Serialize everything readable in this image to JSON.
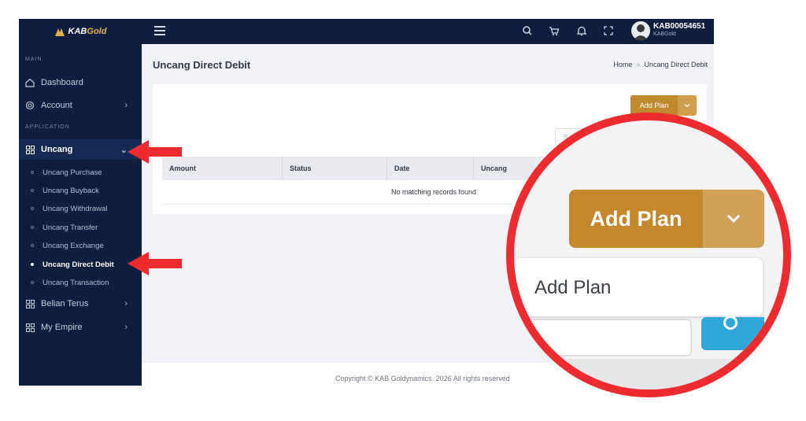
{
  "brand": {
    "logo_text": "KABGold",
    "logo_text_prefix": "KAB",
    "logo_text_suffix": "Gold"
  },
  "sidebar": {
    "section_main": "MAIN",
    "section_application": "APPLICATION",
    "items": [
      {
        "label": "Dashboard",
        "icon": "home-icon"
      },
      {
        "label": "Account",
        "icon": "fingerprint-icon",
        "has_chevron": true
      },
      {
        "label": "Uncang",
        "icon": "grid-icon",
        "active": true,
        "chevron": "⌄"
      },
      {
        "label": "Belian Terus",
        "icon": "grid-icon",
        "has_chevron": true
      },
      {
        "label": "My Empire",
        "icon": "grid-icon",
        "has_chevron": true
      }
    ],
    "sub_items": [
      {
        "label": "Uncang Purchase"
      },
      {
        "label": "Uncang Buyback"
      },
      {
        "label": "Uncang Withdrawal"
      },
      {
        "label": "Uncang Transfer"
      },
      {
        "label": "Uncang Exchange"
      },
      {
        "label": "Uncang Direct Debit",
        "current": true
      },
      {
        "label": "Uncang Transaction"
      }
    ],
    "chevron_right": "›"
  },
  "topbar": {
    "icons": [
      "menu-icon",
      "search-icon",
      "cart-icon",
      "bell-icon",
      "fullscreen-icon"
    ],
    "user_id": "KAB00054651",
    "user_name": "KABGold"
  },
  "page": {
    "title": "Uncang Direct Debit",
    "breadcrumb": {
      "home": "Home",
      "separator": "»",
      "current": "Uncang Direct Debit"
    }
  },
  "card": {
    "add_button_label": "Add Plan",
    "search_placeholder": "S",
    "table": {
      "columns": [
        "Amount",
        "Status",
        "Date",
        "Uncang"
      ],
      "empty_text": "No matching records found"
    }
  },
  "footer": {
    "text": "Copyright © KAB Goldynamics. 2026 All rights reserved"
  },
  "zoom_callout": {
    "button_label": "Add Plan",
    "menu_item_label": "Add Plan"
  },
  "colors": {
    "sidebar_bg": "#0f1e3d",
    "accent_gold": "#c08a2c",
    "annotation_red": "#ee2b2e"
  }
}
